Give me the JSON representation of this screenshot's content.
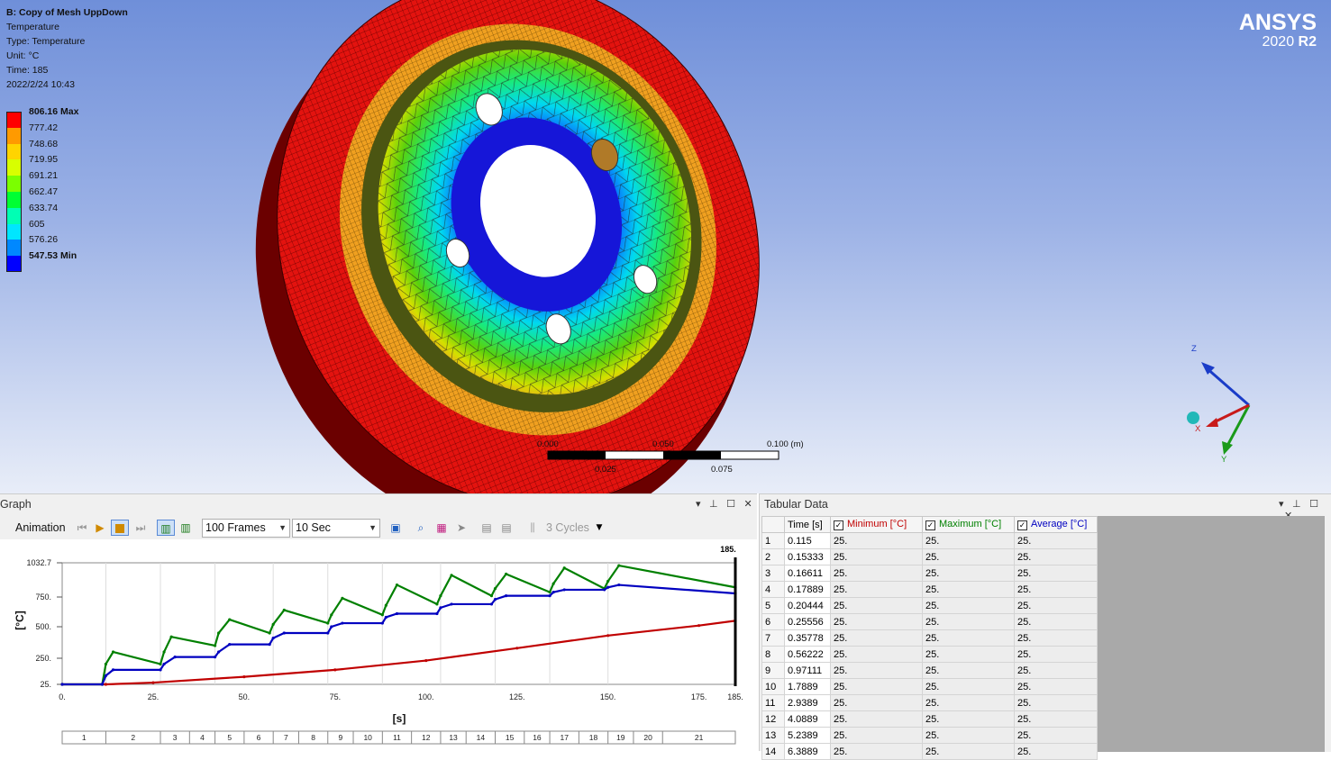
{
  "viewport": {
    "title": "B: Copy of Mesh UppDown",
    "result": "Temperature",
    "type_line": "Type: Temperature",
    "unit_line": "Unit: °C",
    "time_line": "Time: 185",
    "date_line": "2022/2/24 10:43",
    "brand": "ANSYS",
    "version": "2020",
    "release": "R2",
    "legend": [
      {
        "label": "806.16 Max",
        "color": "#ff0000",
        "bold": true
      },
      {
        "label": "777.42",
        "color": "#ff9a00"
      },
      {
        "label": "748.68",
        "color": "#ffd400"
      },
      {
        "label": "719.95",
        "color": "#d8ff00"
      },
      {
        "label": "691.21",
        "color": "#7bff00"
      },
      {
        "label": "662.47",
        "color": "#00ff33"
      },
      {
        "label": "633.74",
        "color": "#00ffb4"
      },
      {
        "label": "605",
        "color": "#00e6ff"
      },
      {
        "label": "576.26",
        "color": "#0088ff"
      },
      {
        "label": "547.53 Min",
        "color": "#0000ff",
        "bold": true
      }
    ],
    "scale": {
      "l0": "0.000",
      "l1": "0.050",
      "l2": "0.100 (m)",
      "l3": "0.025",
      "l4": "0.075"
    },
    "triad": {
      "z": "Z",
      "x": "X",
      "y": "Y"
    }
  },
  "graph": {
    "title": "Graph",
    "animation_label": "Animation",
    "frames": "100 Frames",
    "duration": "10 Sec",
    "cycles": "3 Cycles",
    "pin": "▾ 🖈 ☐ ✕",
    "x_axis_label": "[s]",
    "y_axis_label": "[°C]",
    "cursor_label": "185.",
    "y_ticks": [
      "1032.7",
      "750.",
      "500.",
      "250.",
      "25."
    ],
    "x_ticks": [
      "0.",
      "25.",
      "50.",
      "75.",
      "100.",
      "125.",
      "150.",
      "175.",
      "185."
    ],
    "steps": [
      "1",
      "2",
      "3",
      "4",
      "5",
      "6",
      "7",
      "8",
      "9",
      "10",
      "11",
      "12",
      "13",
      "14",
      "15",
      "16",
      "17",
      "18",
      "19",
      "20",
      "21"
    ]
  },
  "tabular": {
    "title": "Tabular Data",
    "headers": {
      "time": "Time [s]",
      "min": "Minimum [°C]",
      "max": "Maximum [°C]",
      "avg": "Average [°C]"
    },
    "rows": [
      [
        "1",
        "0.115",
        "25.",
        "25.",
        "25."
      ],
      [
        "2",
        "0.15333",
        "25.",
        "25.",
        "25."
      ],
      [
        "3",
        "0.16611",
        "25.",
        "25.",
        "25."
      ],
      [
        "4",
        "0.17889",
        "25.",
        "25.",
        "25."
      ],
      [
        "5",
        "0.20444",
        "25.",
        "25.",
        "25."
      ],
      [
        "6",
        "0.25556",
        "25.",
        "25.",
        "25."
      ],
      [
        "7",
        "0.35778",
        "25.",
        "25.",
        "25."
      ],
      [
        "8",
        "0.56222",
        "25.",
        "25.",
        "25."
      ],
      [
        "9",
        "0.97111",
        "25.",
        "25.",
        "25."
      ],
      [
        "10",
        "1.7889",
        "25.",
        "25.",
        "25."
      ],
      [
        "11",
        "2.9389",
        "25.",
        "25.",
        "25."
      ],
      [
        "12",
        "4.0889",
        "25.",
        "25.",
        "25."
      ],
      [
        "13",
        "5.2389",
        "25.",
        "25.",
        "25."
      ],
      [
        "14",
        "6.3889",
        "25.",
        "25.",
        "25."
      ]
    ]
  },
  "chart_data": {
    "type": "line",
    "xlabel": "[s]",
    "ylabel": "[°C]",
    "xlim": [
      0,
      185
    ],
    "ylim": [
      25,
      1032.7
    ],
    "series": [
      {
        "name": "Minimum [°C]",
        "color": "#c00000",
        "x": [
          0,
          12,
          25,
          50,
          75,
          100,
          125,
          150,
          175,
          185
        ],
        "values": [
          25,
          25,
          40,
          90,
          150,
          230,
          330,
          430,
          510,
          550
        ]
      },
      {
        "name": "Maximum [°C]",
        "color": "#008000",
        "x": [
          0,
          11,
          12,
          14,
          27,
          28,
          30,
          42,
          43,
          46,
          57,
          58,
          61,
          73,
          74,
          77,
          88,
          89,
          92,
          103,
          104,
          107,
          118,
          119,
          122,
          134,
          135,
          138,
          149,
          150,
          153,
          185
        ],
        "values": [
          25,
          25,
          200,
          300,
          200,
          300,
          420,
          350,
          450,
          560,
          450,
          520,
          640,
          530,
          600,
          740,
          600,
          680,
          850,
          690,
          760,
          930,
          760,
          820,
          940,
          790,
          860,
          990,
          820,
          880,
          1010,
          830
        ]
      },
      {
        "name": "Average [°C]",
        "color": "#0000c0",
        "x": [
          0,
          11,
          12,
          14,
          27,
          28,
          31,
          42,
          43,
          46,
          57,
          58,
          61,
          73,
          74,
          77,
          88,
          89,
          92,
          103,
          104,
          107,
          118,
          119,
          122,
          134,
          135,
          138,
          149,
          150,
          153,
          185
        ],
        "values": [
          25,
          25,
          100,
          150,
          150,
          200,
          260,
          260,
          300,
          360,
          360,
          410,
          450,
          450,
          500,
          530,
          530,
          580,
          610,
          610,
          660,
          690,
          690,
          730,
          760,
          760,
          790,
          810,
          810,
          830,
          850,
          780
        ]
      }
    ]
  }
}
